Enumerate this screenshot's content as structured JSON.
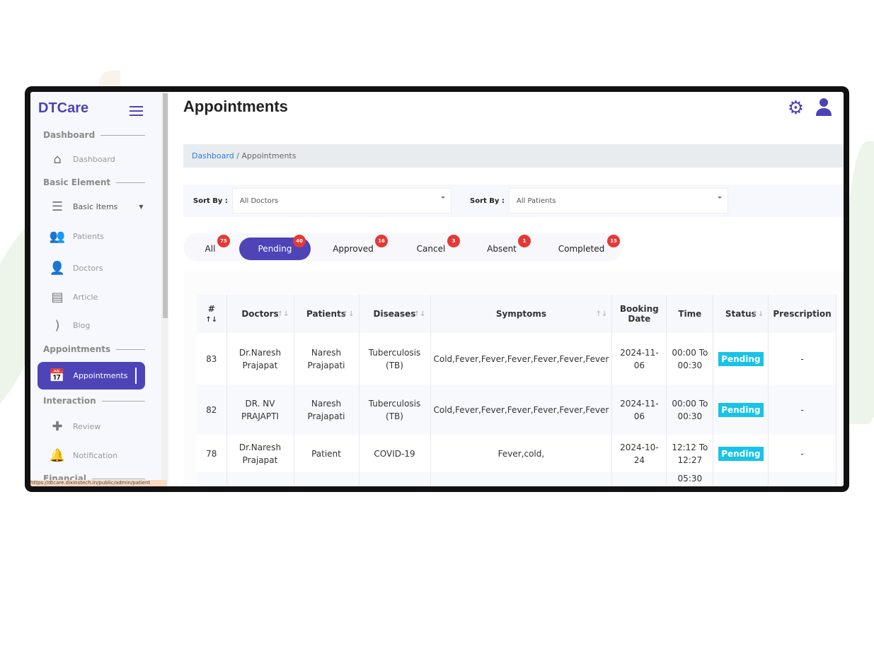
{
  "app": {
    "logo": "DTCare",
    "title": "Appointments",
    "url": "https://dtcare.dixinstech.in/public/admin/patient"
  },
  "sidebar": {
    "sections": [
      "Dashboard",
      "Basic Element",
      "Appointments",
      "Interaction",
      "Financial"
    ],
    "items": [
      {
        "label": "Dashboard",
        "icon": "home-icon"
      },
      {
        "label": "Basic Items",
        "icon": "sliders-icon"
      },
      {
        "label": "Patients",
        "icon": "users-icon"
      },
      {
        "label": "Doctors",
        "icon": "doctor-icon"
      },
      {
        "label": "Article",
        "icon": "book-icon"
      },
      {
        "label": "Blog",
        "icon": "blog-icon"
      },
      {
        "label": "Appointments",
        "icon": "calendar-check-icon"
      },
      {
        "label": "Review",
        "icon": "review-icon"
      },
      {
        "label": "Notification",
        "icon": "bell-icon"
      }
    ]
  },
  "breadcrumb": {
    "home": "Dashboard",
    "sep": "/",
    "current": "Appointments"
  },
  "sort": {
    "label": "Sort By :",
    "doctor": "All Doctors",
    "patient": "All Patients"
  },
  "tabs": [
    {
      "label": "All",
      "count": "75"
    },
    {
      "label": "Pending",
      "count": "40"
    },
    {
      "label": "Approved",
      "count": "16"
    },
    {
      "label": "Cancel",
      "count": "3"
    },
    {
      "label": "Absent",
      "count": "1"
    },
    {
      "label": "Completed",
      "count": "15"
    }
  ],
  "colors": {
    "accent": "#4e44b8",
    "badge": "#e53935",
    "pending": "#17c3e8"
  },
  "table": {
    "headers": [
      "#",
      "Doctors",
      "Patients",
      "Diseases",
      "Symptoms",
      "Booking Date",
      "Time",
      "Status",
      "Prescription"
    ],
    "rows": [
      [
        "83",
        "Dr.Naresh Prajapat",
        "Naresh Prajapati",
        "Tuberculosis (TB)",
        "Cold,Fever,Fever,Fever,Fever,Fever,Fever",
        "2024-11-06",
        "00:00 To 00:30",
        "Pending",
        "-"
      ],
      [
        "82",
        "DR. NV PRAJAPTI",
        "Naresh Prajapati",
        "Tuberculosis (TB)",
        "Cold,Fever,Fever,Fever,Fever,Fever,Fever",
        "2024-11-06",
        "00:00 To 00:30",
        "Pending",
        "-"
      ],
      [
        "78",
        "Dr.Naresh Prajapat",
        "Patient",
        "COVID-19",
        "Fever,cold,",
        "2024-10-24",
        "12:12 To 12:27",
        "Pending",
        "-"
      ],
      [
        "",
        "",
        "",
        "",
        "",
        "",
        "05:30",
        "",
        ""
      ]
    ]
  }
}
